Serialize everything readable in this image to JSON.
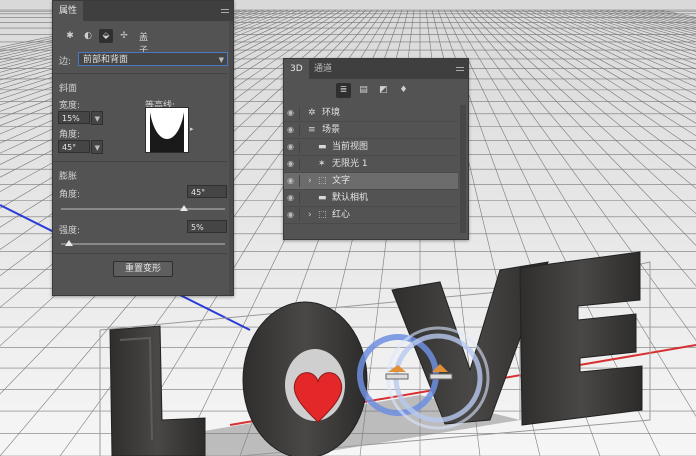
{
  "properties_panel": {
    "title": "属性",
    "icons": [
      {
        "icon": "mesh-icon",
        "glyph": "✱"
      },
      {
        "icon": "deform-icon",
        "glyph": "◐"
      },
      {
        "icon": "cap-icon",
        "glyph": "⬙"
      },
      {
        "icon": "coordinates-icon",
        "glyph": "✢"
      }
    ],
    "section_name": "盖子",
    "edge_label": "边:",
    "edge_value": "前部和背面",
    "bevel_title": "斜面",
    "width_label": "宽度:",
    "width_value": "15%",
    "contour_label": "等高线:",
    "angle_label": "角度:",
    "angle_value": "45°",
    "inflate_title": "膨胀",
    "inflate_angle_label": "角度:",
    "inflate_angle_value": "45°",
    "inflate_angle_level": 0.75,
    "strength_label": "强度:",
    "strength_value": "5%",
    "strength_level": 0.05,
    "reset_button": "重置变形"
  },
  "panel_3d": {
    "tab_3d": "3D",
    "tab_channels": "通道",
    "tools": [
      "whole-scene-icon",
      "meshes-icon",
      "materials-icon",
      "lights-icon"
    ],
    "layers": [
      {
        "name": "环境",
        "icon": "environment-icon",
        "glyph": "✲",
        "indent": 0,
        "expandable": false,
        "selected": false
      },
      {
        "name": "场景",
        "icon": "scene-icon",
        "glyph": "≡",
        "indent": 0,
        "expandable": false,
        "selected": false
      },
      {
        "name": "当前视图",
        "icon": "camera-icon",
        "glyph": "▬",
        "indent": 1,
        "expandable": false,
        "selected": false
      },
      {
        "name": "无限光 1",
        "icon": "infinite-light-icon",
        "glyph": "✶",
        "indent": 1,
        "expandable": false,
        "selected": false
      },
      {
        "name": "文字",
        "icon": "mesh-icon",
        "glyph": "⬚",
        "indent": 1,
        "expandable": true,
        "selected": true
      },
      {
        "name": "默认相机",
        "icon": "camera-icon",
        "glyph": "▬",
        "indent": 1,
        "expandable": false,
        "selected": false
      },
      {
        "name": "红心",
        "icon": "mesh-icon",
        "glyph": "⬚",
        "indent": 1,
        "expandable": true,
        "selected": false
      }
    ]
  },
  "colors": {
    "panel_bg": "#535353",
    "selection_accent": "#4a78c4",
    "heart_red": "#e4282a",
    "letter_dark": "#3e3c3a",
    "widget_blue": "#6f8fe0"
  }
}
